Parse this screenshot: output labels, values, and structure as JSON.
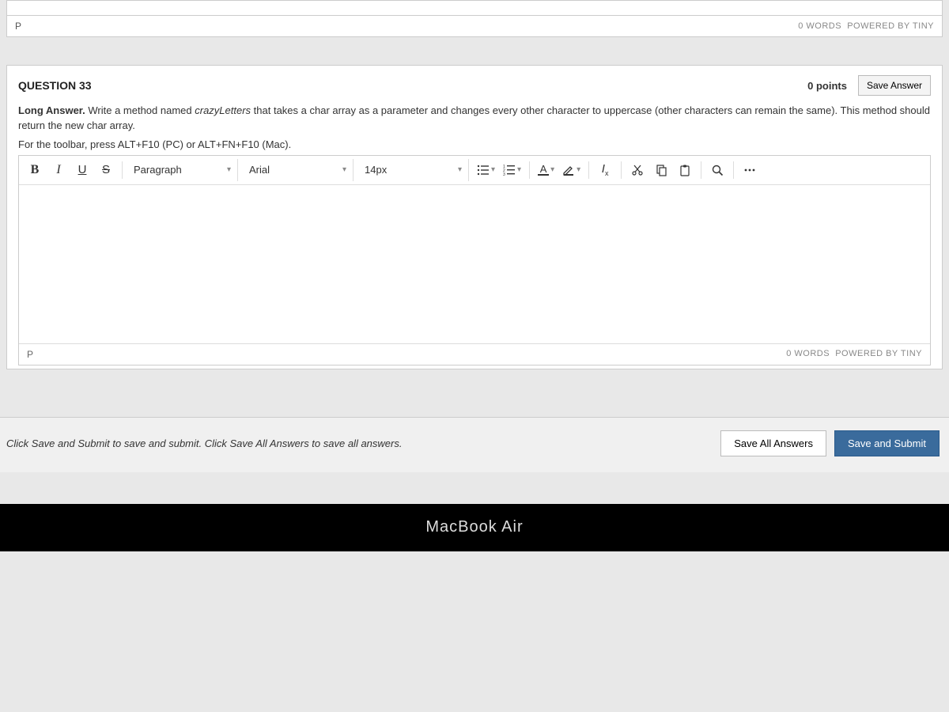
{
  "top_editor": {
    "path": "P",
    "word_count": "0 WORDS",
    "powered": "POWERED BY TINY"
  },
  "question": {
    "title": "QUESTION 33",
    "points": "0 points",
    "save_label": "Save Answer",
    "prompt_strong": "Long Answer.",
    "prompt_text_1": " Write a method named ",
    "prompt_ital": "crazyLetters",
    "prompt_text_2": " that takes a char array as a parameter and changes every other character to uppercase (other characters can remain the same). This method should return the new char array.",
    "toolbar_hint": "For the toolbar, press ALT+F10 (PC) or ALT+FN+F10 (Mac)."
  },
  "rte": {
    "format": "Paragraph",
    "font": "Arial",
    "size": "14px",
    "path": "P",
    "word_count": "0 WORDS",
    "powered": "POWERED BY TINY"
  },
  "footer": {
    "hint": "Click Save and Submit to save and submit. Click Save All Answers to save all answers.",
    "save_all": "Save All Answers",
    "save_submit": "Save and Submit"
  },
  "mac": "MacBook Air"
}
